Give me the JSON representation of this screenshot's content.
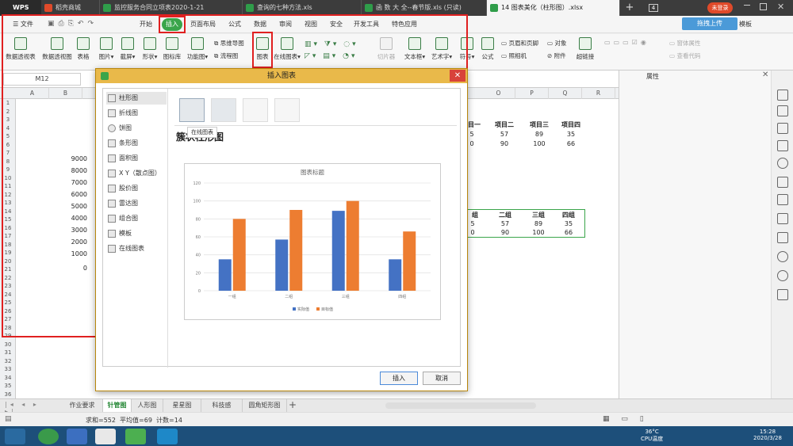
{
  "app": {
    "name": "WPS",
    "login_label": "未登录",
    "upload_label": "拖拽上传",
    "tabs": [
      {
        "label": "稻壳商城"
      },
      {
        "label": "监控服务合同立项表2020-1-21"
      },
      {
        "label": "查询的七种方法.xls"
      },
      {
        "label": "函 数 大 全--春节版.xls (只读)"
      },
      {
        "label": "14 图表美化（柱形图）.xlsx"
      }
    ],
    "tab_count": "4"
  },
  "menu": {
    "file": "文件",
    "items": [
      "开始",
      "插入",
      "页面布局",
      "公式",
      "数据",
      "审阅",
      "视图",
      "安全",
      "开发工具",
      "特色应用"
    ],
    "right_tail": "模板"
  },
  "ribbon": {
    "pivot_table": "数据透视表",
    "pivot_chart": "数据透视图",
    "table": "表格",
    "picture": "图片",
    "screenshot": "截屏",
    "shape": "形状",
    "icon_lib": "图标库",
    "func_chart": "功能图",
    "mindmap": "思维导图",
    "flowchart": "流程图",
    "chart": "图表",
    "online_chart": "在线图表",
    "slicer": "切片器",
    "textbox": "文本框",
    "wordart": "艺术字",
    "symbol": "符号",
    "formula": "公式",
    "header_footer": "页眉和页脚",
    "object": "对象",
    "camera": "照相机",
    "attachment": "附件",
    "hyperlink": "超链接",
    "form_props": "窗体属性",
    "view_code": "查看代码"
  },
  "formula_bar": {
    "cell_ref": "M12"
  },
  "right_panel": {
    "title": "属性"
  },
  "sheet": {
    "columns": [
      "A",
      "B",
      "O",
      "P",
      "Q",
      "R"
    ],
    "rows": [
      "1",
      "2",
      "3",
      "4",
      "5",
      "6",
      "7",
      "8",
      "9",
      "10",
      "11",
      "12",
      "13",
      "14",
      "15",
      "16",
      "17",
      "18",
      "19",
      "20",
      "21",
      "22",
      "23",
      "24",
      "25",
      "26",
      "27",
      "28",
      "29",
      "30",
      "31",
      "32",
      "33",
      "34",
      "35",
      "36"
    ],
    "y_axis_ticks": [
      "9000",
      "8000",
      "7000",
      "6000",
      "5000",
      "4000",
      "3000",
      "2000",
      "1000",
      "0"
    ],
    "table1": {
      "headers": [
        "目一",
        "项目二",
        "项目三",
        "项目四"
      ],
      "row1": [
        "5",
        "57",
        "89",
        "35"
      ],
      "row2": [
        "0",
        "90",
        "100",
        "66"
      ]
    },
    "table2": {
      "headers": [
        "组",
        "二组",
        "三组",
        "四组"
      ],
      "row1": [
        "5",
        "57",
        "89",
        "35"
      ],
      "row2": [
        "0",
        "90",
        "100",
        "66"
      ]
    }
  },
  "sheet_tabs": [
    "作业要求",
    "针管图",
    "人形图",
    "星星图",
    "科技感",
    "圆角矩形图"
  ],
  "status": {
    "summary": "求和=552  平均值=69  计数=14"
  },
  "taskbar": {
    "temp": "36°C",
    "cpu": "CPU温度",
    "time": "15:28",
    "date": "2020/3/28"
  },
  "dialog": {
    "title": "插入图表",
    "categories": [
      "柱形图",
      "折线图",
      "饼图",
      "条形图",
      "面积图",
      "X Y（散点图）",
      "股价图",
      "雷达图",
      "组合图",
      "模板",
      "在线图表"
    ],
    "selected_category": "柱形图",
    "subtype_title": "簇状柱形图",
    "tooltip": "在线图表",
    "insert_label": "插入",
    "cancel_label": "取消"
  },
  "chart_data": {
    "type": "bar",
    "title": "图表标题",
    "categories": [
      "一组",
      "二组",
      "三组",
      "四组"
    ],
    "series": [
      {
        "name": "实际值",
        "values": [
          35,
          57,
          89,
          35
        ],
        "color": "#4472c4"
      },
      {
        "name": "目标值",
        "values": [
          80,
          90,
          100,
          66
        ],
        "color": "#ed7d31"
      }
    ],
    "yticks": [
      "0",
      "20",
      "40",
      "60",
      "80",
      "100",
      "120"
    ],
    "ylim": [
      0,
      120
    ],
    "grid": true,
    "legend": "bottom"
  },
  "colors": {
    "accent": "#3aa54a",
    "highlight": "#e02020",
    "dialog_title": "#e9b94a"
  }
}
